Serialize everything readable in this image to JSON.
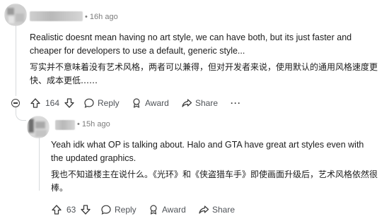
{
  "comments": [
    {
      "time": "16h ago",
      "text_en": "Realistic doesnt mean having no art style, we can have both, but its just faster and cheaper for developers to use a default, generic style...",
      "text_zh": "写实并不意味着没有艺术风格，两者可以兼得，但对开发者来说，使用默认的通用风格速度更快、成本更低……",
      "votes": "164",
      "reply_label": "Reply",
      "award_label": "Award",
      "share_label": "Share",
      "more_label": "···"
    },
    {
      "time": "15h ago",
      "text_en": "Yeah idk what OP is talking about. Halo and GTA have great art styles even with the updated graphics.",
      "text_zh": "我也不知道楼主在说什么。《光环》和《侠盗猎车手》即使画面升级后，艺术风格依然很棒。",
      "votes": "63",
      "reply_label": "Reply",
      "award_label": "Award",
      "share_label": "Share"
    }
  ],
  "colors": {
    "thread_line": "#d7dadc",
    "meta_text": "#7c7c7c",
    "action_text": "#4f5358"
  },
  "icons": [
    "collapse-thread-icon",
    "upvote-icon",
    "downvote-icon",
    "reply-bubble-icon",
    "award-icon",
    "share-icon",
    "more-options-icon"
  ]
}
